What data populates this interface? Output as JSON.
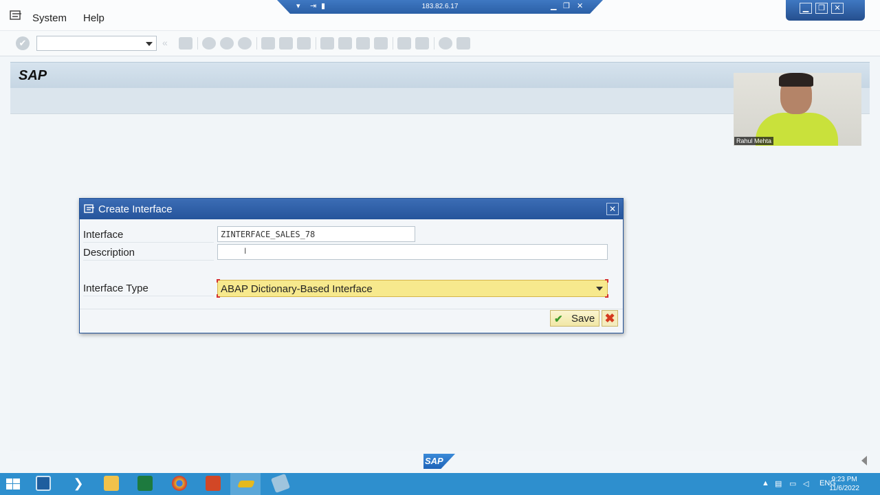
{
  "menubar": {
    "system": "System",
    "help": "Help"
  },
  "remote": {
    "ip": "183.82.6.17"
  },
  "header": {
    "title": "SAP"
  },
  "video": {
    "name": "Rahul Mehta"
  },
  "dialog": {
    "title": "Create Interface",
    "interface_label": "Interface",
    "interface_value": "ZINTERFACE_SALES_78",
    "description_label": "Description",
    "description_value": "",
    "type_label": "Interface Type",
    "type_value": "ABAP Dictionary-Based Interface",
    "save_label": "Save"
  },
  "footer": {
    "logo": "SAP"
  },
  "taskbar": {
    "lang": "ENG",
    "time": "9:23 PM",
    "date": "11/6/2022"
  },
  "colors": {
    "titlebar": "#2b5fa6",
    "taskbar": "#2e8fce",
    "select_bg": "#f7e98d"
  },
  "icons": [
    "menu-icon",
    "enter-icon",
    "save-icon",
    "print-icon",
    "find-icon",
    "help-icon",
    "close-icon",
    "check-icon",
    "cancel-icon",
    "windows-icon",
    "chrome-icon",
    "excel-icon",
    "powerpoint-icon"
  ]
}
